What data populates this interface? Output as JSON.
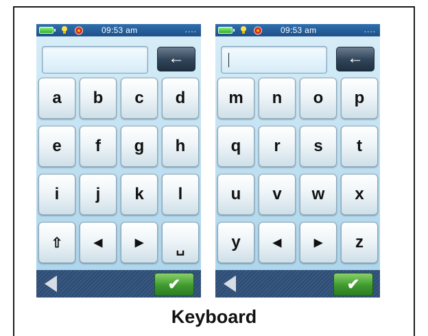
{
  "caption": "Keyboard",
  "screens": [
    {
      "time": "09:53 am",
      "status_dots": "....",
      "input_value": "",
      "cursor_visible": false,
      "backspace_glyph": "←",
      "keys": [
        [
          "a",
          "b",
          "c",
          "d"
        ],
        [
          "e",
          "f",
          "g",
          "h"
        ],
        [
          "i",
          "j",
          "k",
          "l"
        ],
        [
          "⇧",
          "◀",
          "▶",
          "␣"
        ]
      ],
      "ok_glyph": "✔"
    },
    {
      "time": "09:53 am",
      "status_dots": "....",
      "input_value": "",
      "cursor_visible": true,
      "backspace_glyph": "←",
      "keys": [
        [
          "m",
          "n",
          "o",
          "p"
        ],
        [
          "q",
          "r",
          "s",
          "t"
        ],
        [
          "u",
          "v",
          "w",
          "x"
        ],
        [
          "y",
          "◀",
          "▶",
          "z"
        ]
      ],
      "ok_glyph": "✔"
    }
  ],
  "icons": {
    "battery": "battery-icon",
    "bulb": "bulb-icon",
    "alarm": "alarm-icon",
    "back": "back-arrow-icon",
    "ok": "checkmark-icon"
  },
  "colors": {
    "statusbar": "#1f4f88",
    "bottombar": "#2d4b72",
    "ok_button": "#3e9a2e",
    "key_text": "#111111"
  }
}
